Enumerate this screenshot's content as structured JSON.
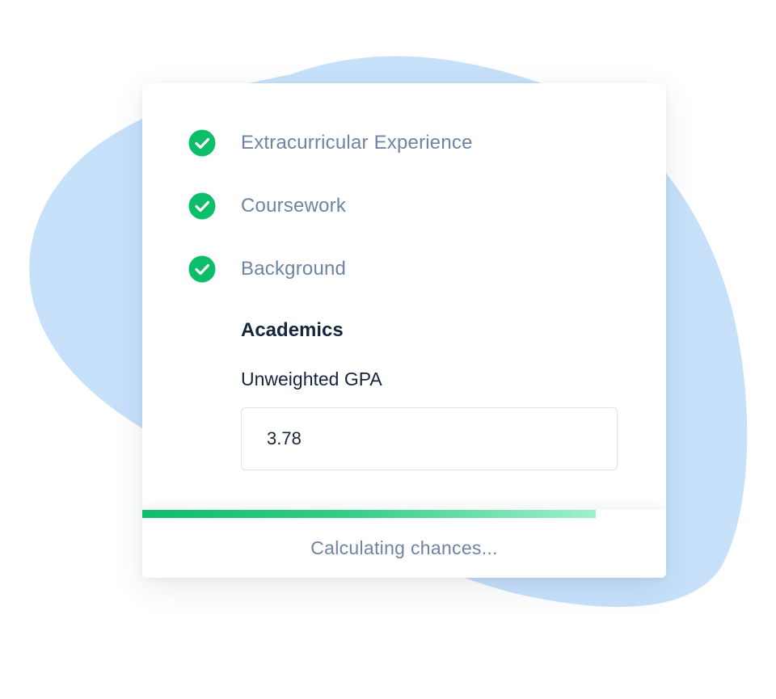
{
  "colors": {
    "check_green": "#0cbe6a",
    "muted_label": "#6e84a3",
    "dark_text": "#15253c",
    "blob_blue": "#c7e1fb"
  },
  "steps": [
    {
      "label": "Extracurricular Experience",
      "icon": "check-circle-icon",
      "completed": true
    },
    {
      "label": "Coursework",
      "icon": "check-circle-icon",
      "completed": true
    },
    {
      "label": "Background",
      "icon": "check-circle-icon",
      "completed": true
    }
  ],
  "academics": {
    "section_title": "Academics",
    "gpa_label": "Unweighted GPA",
    "gpa_value": "3.78"
  },
  "progress": {
    "fraction": 0.866,
    "status_text": "Calculating chances..."
  }
}
